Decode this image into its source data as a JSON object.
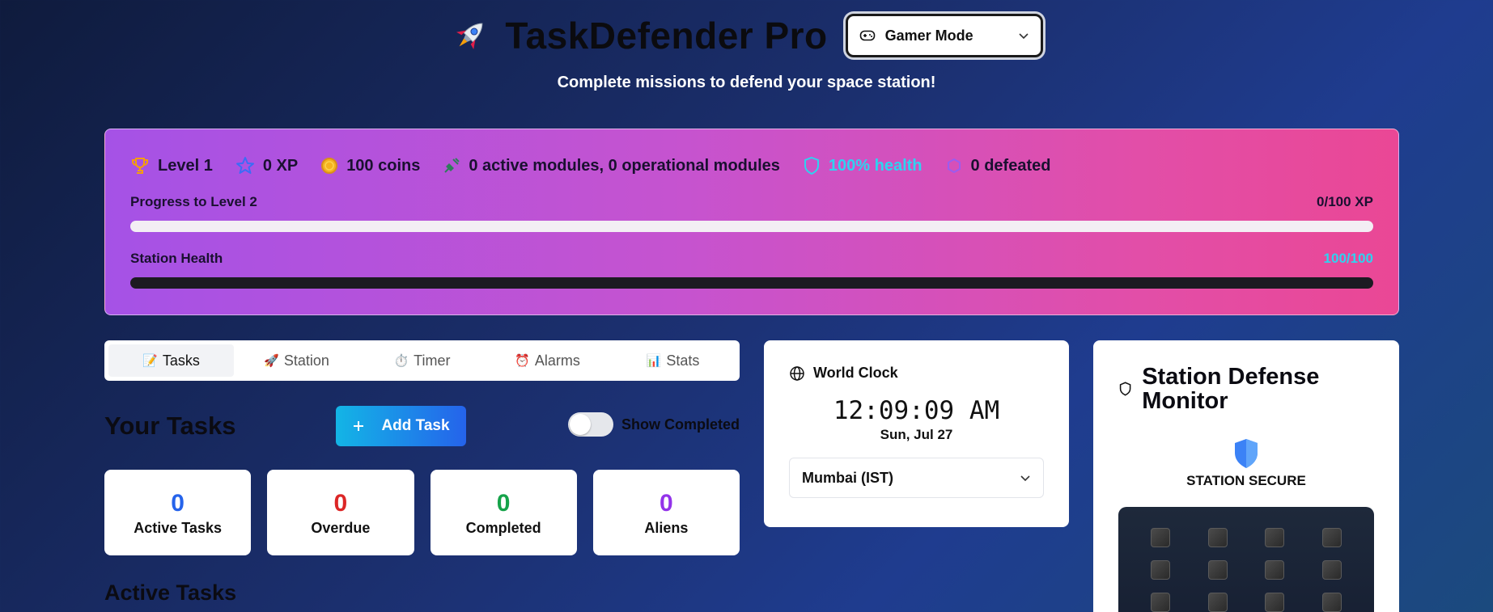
{
  "header": {
    "title": "TaskDefender Pro",
    "mode_select": {
      "value": "Gamer Mode"
    },
    "subtitle": "Complete missions to defend your space station!"
  },
  "stats": {
    "level": "Level 1",
    "xp": "0 XP",
    "coins": "100 coins",
    "modules": "0 active modules, 0 operational modules",
    "health": "100% health",
    "defeated": "0 defeated",
    "progress_label": "Progress to Level 2",
    "progress_value": "0/100 XP",
    "progress_fraction": 0,
    "health_label": "Station Health",
    "health_value": "100/100",
    "health_fraction": 1.0,
    "health_color": "#2ed3f0"
  },
  "tabs": [
    {
      "label": "Tasks",
      "emoji": "📝",
      "active": true
    },
    {
      "label": "Station",
      "emoji": "🚀",
      "active": false
    },
    {
      "label": "Timer",
      "emoji": "⏱️",
      "active": false
    },
    {
      "label": "Alarms",
      "emoji": "⏰",
      "active": false
    },
    {
      "label": "Stats",
      "emoji": "📊",
      "active": false
    }
  ],
  "tasks": {
    "title": "Your Tasks",
    "add_label": "Add Task",
    "toggle_label": "Show Completed",
    "cards": [
      {
        "value": "0",
        "label": "Active Tasks",
        "color": "#2563eb"
      },
      {
        "value": "0",
        "label": "Overdue",
        "color": "#dc2626"
      },
      {
        "value": "0",
        "label": "Completed",
        "color": "#16a34a"
      },
      {
        "value": "0",
        "label": "Aliens",
        "color": "#9333ea"
      }
    ],
    "active_heading": "Active Tasks"
  },
  "clock": {
    "title": "World Clock",
    "time": "12:09:09 AM",
    "date": "Sun, Jul 27",
    "timezone": "Mumbai (IST)"
  },
  "defense": {
    "title": "Station Defense Monitor",
    "status": "STATION SECURE"
  },
  "icons": {
    "rocket": "rocket-icon",
    "gamepad": "gamepad-icon",
    "trophy": "trophy-icon",
    "star": "star-icon",
    "coin": "coin-icon",
    "satellite": "satellite-icon",
    "shield": "shield-icon",
    "alien": "alien-icon",
    "globe": "globe-icon",
    "plus": "plus-icon",
    "chevron": "chevron-down-icon"
  }
}
